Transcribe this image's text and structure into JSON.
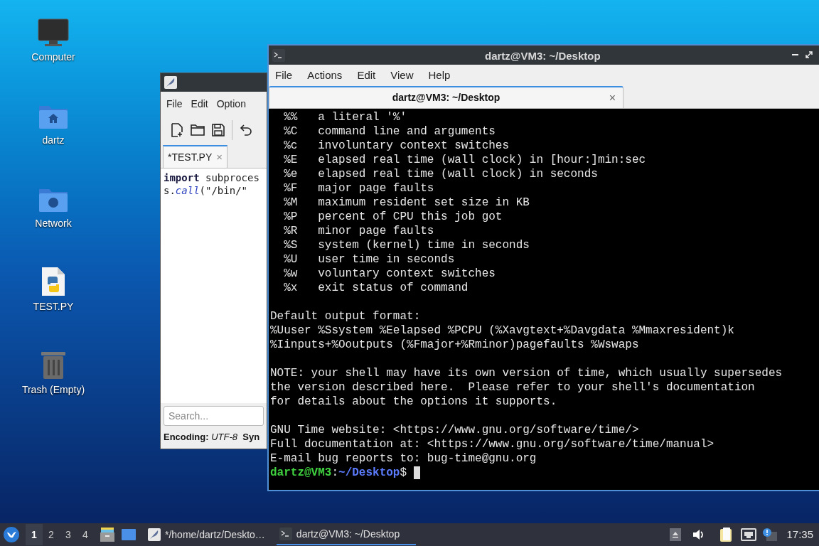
{
  "desktop_icons": [
    {
      "label": "Computer",
      "kind": "computer"
    },
    {
      "label": "dartz",
      "kind": "home"
    },
    {
      "label": "Network",
      "kind": "network"
    },
    {
      "label": "TEST.PY",
      "kind": "python"
    },
    {
      "label": "Trash (Empty)",
      "kind": "trash"
    }
  ],
  "editor": {
    "menu": [
      "File",
      "Edit",
      "Option"
    ],
    "tab": {
      "label": "*TEST.PY",
      "close": "×"
    },
    "code": [
      [
        {
          "text": "import",
          "kind": "keyword"
        },
        {
          "text": " subproces",
          "kind": "plain"
        }
      ],
      [
        {
          "text": "s.",
          "kind": "plain"
        },
        {
          "text": "call",
          "kind": "function"
        },
        {
          "text": "(\"/bin/\"",
          "kind": "plain"
        }
      ]
    ],
    "search": {
      "placeholder": "Search..."
    },
    "status": "**Encoding:** *UTF-8*  **Syn**"
  },
  "terminal": {
    "title": "dartz@VM3: ~/Desktop",
    "menu": [
      "File",
      "Actions",
      "Edit",
      "View",
      "Help"
    ],
    "tab": {
      "label": "dartz@VM3: ~/Desktop",
      "close": "×"
    },
    "output": [
      [
        "  %%   a literal '%'",
        "  %C   command line and arguments",
        "  %c   involuntary context switches",
        "  %E   elapsed real time (wall clock) in [hour:]min:sec",
        "  %e   elapsed real time (wall clock) in seconds",
        "  %F   major page faults",
        "  %M   maximum resident set size in KB",
        "  %P   percent of CPU this job got",
        "  %R   minor page faults",
        "  %S   system (kernel) time in seconds",
        "  %U   user time in seconds",
        "  %w   voluntary context switches",
        "  %x   exit status of command"
      ],
      [
        "Default output format:",
        "%Uuser %Ssystem %Eelapsed %PCPU (%Xavgtext+%Davgdata %Mmaxresident)k",
        "%Iinputs+%Ooutputs (%Fmajor+%Rminor)pagefaults %Wswaps"
      ],
      [
        "NOTE: your shell may have its own version of time, which usually supersedes",
        "the version described here.  Please refer to your shell's documentation",
        "for details about the options it supports."
      ],
      [
        "GNU Time website: <https://www.gnu.org/software/time/>",
        "Full documentation at: <https://www.gnu.org/software/time/manual>",
        "E-mail bug reports to: bug-time@gnu.org"
      ]
    ],
    "prompt": [
      {
        "text": "dartz@VM3",
        "kind": "user"
      },
      {
        "text": ":",
        "kind": "plain"
      },
      {
        "text": "~/Desktop",
        "kind": "path"
      },
      {
        "text": "$ ",
        "kind": "plain"
      }
    ]
  },
  "taskbar": {
    "workspaces": [
      {
        "label": "1",
        "selected": true
      },
      {
        "label": "2",
        "selected": false
      },
      {
        "label": "3",
        "selected": false
      },
      {
        "label": "4",
        "selected": false
      }
    ],
    "tasks": [
      {
        "label": "*/home/dartz/Deskto…",
        "kind": "editor",
        "selected": false
      },
      {
        "label": "dartz@VM3: ~/Desktop",
        "kind": "terminal",
        "selected": true
      }
    ],
    "clock": "17:35"
  }
}
